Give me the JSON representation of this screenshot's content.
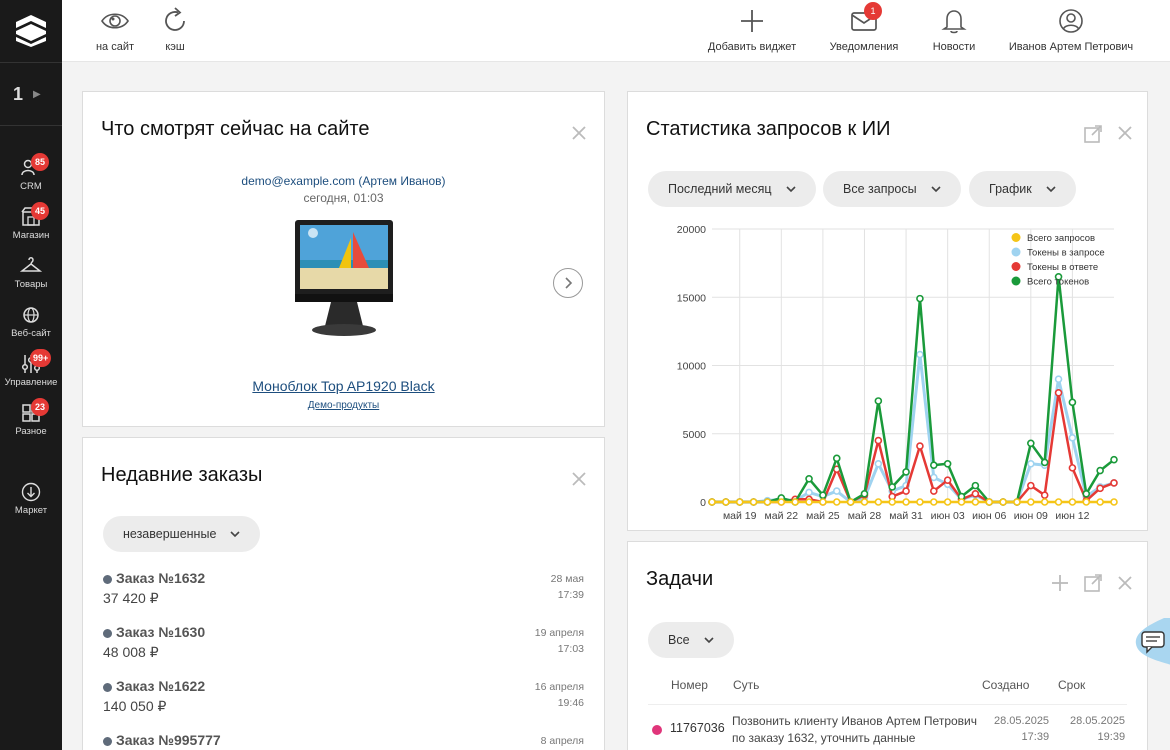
{
  "sidebar": {
    "site_number": "1",
    "items": [
      {
        "label": "CRM",
        "icon": "crm-icon",
        "badge": "85"
      },
      {
        "label": "Магазин",
        "icon": "shop-icon",
        "badge": "45"
      },
      {
        "label": "Товары",
        "icon": "hanger-icon",
        "badge": ""
      },
      {
        "label": "Веб-сайт",
        "icon": "globe-icon",
        "badge": ""
      },
      {
        "label": "Управление",
        "icon": "sliders-icon",
        "badge": "99+"
      },
      {
        "label": "Разное",
        "icon": "grid-icon",
        "badge": "23"
      },
      {
        "label": "Маркет",
        "icon": "download-icon",
        "badge": ""
      }
    ]
  },
  "topbar": {
    "view_site": "на сайт",
    "cache": "кэш",
    "add_widget": "Добавить виджет",
    "notifications": "Уведомления",
    "notifications_badge": "1",
    "news": "Новости",
    "user": "Иванов Артем Петрович"
  },
  "now_viewing": {
    "title": "Что смотрят сейчас на сайте",
    "email": "demo@example.com (Артем Иванов)",
    "time": "сегодня, 01:03",
    "product": "Моноблок Top AP1920 Black",
    "category": "Демо-продукты"
  },
  "orders": {
    "title": "Недавние заказы",
    "filter": "незавершенные",
    "items": [
      {
        "name": "Заказ №1632",
        "sum": "37 420 ₽",
        "date": "28 мая",
        "time": "17:39"
      },
      {
        "name": "Заказ №1630",
        "sum": "48 008 ₽",
        "date": "19 апреля",
        "time": "17:03"
      },
      {
        "name": "Заказ №1622",
        "sum": "140 050 ₽",
        "date": "16 апреля",
        "time": "19:46"
      },
      {
        "name": "Заказ №995777",
        "sum": "",
        "date": "8 апреля",
        "time": ""
      }
    ]
  },
  "ai_stats": {
    "title": "Статистика запросов к ИИ",
    "filters": [
      "Последний месяц",
      "Все запросы",
      "График"
    ]
  },
  "chart_data": {
    "type": "line",
    "x": [
      "май 17",
      "май 18",
      "май 19",
      "май 20",
      "май 21",
      "май 22",
      "май 23",
      "май 24",
      "май 25",
      "май 26",
      "май 27",
      "май 28",
      "май 29",
      "май 30",
      "май 31",
      "июн 01",
      "июн 02",
      "июн 03",
      "июн 04",
      "июн 05",
      "июн 06",
      "июн 07",
      "июн 08",
      "июн 09",
      "июн 10",
      "июн 11",
      "июн 12",
      "июн 13",
      "июн 14",
      "июн 15"
    ],
    "tick_labels": [
      "май 19",
      "май 22",
      "май 25",
      "май 28",
      "май 31",
      "июн 03",
      "июн 06",
      "июн 09",
      "июн 12"
    ],
    "ylim": [
      0,
      20000
    ],
    "yticks": [
      0,
      5000,
      10000,
      15000,
      20000
    ],
    "legend_position": "top-right",
    "series": [
      {
        "name": "Всего запросов",
        "color": "#f5c518",
        "values": [
          0,
          0,
          0,
          0,
          0,
          0,
          0,
          0,
          0,
          0,
          0,
          0,
          0,
          0,
          0,
          0,
          0,
          0,
          0,
          0,
          0,
          0,
          0,
          0,
          0,
          0,
          0,
          0,
          0,
          0
        ]
      },
      {
        "name": "Токены в запросе",
        "color": "#9fd3f0",
        "values": [
          0,
          0,
          0,
          0,
          100,
          200,
          100,
          700,
          400,
          800,
          0,
          300,
          2800,
          800,
          1200,
          10800,
          1800,
          1300,
          200,
          500,
          0,
          0,
          0,
          2800,
          2700,
          9000,
          4700,
          400,
          1100,
          1400
        ]
      },
      {
        "name": "Токены в ответе",
        "color": "#e53935",
        "values": [
          0,
          0,
          0,
          0,
          0,
          0,
          200,
          200,
          0,
          2400,
          0,
          500,
          4500,
          400,
          800,
          4100,
          800,
          1600,
          200,
          600,
          0,
          0,
          0,
          1200,
          500,
          8000,
          2500,
          100,
          1000,
          1400
        ]
      },
      {
        "name": "Всего токенов",
        "color": "#1a9a3a",
        "values": [
          0,
          0,
          0,
          0,
          0,
          300,
          0,
          1700,
          500,
          3200,
          0,
          600,
          7400,
          1100,
          2200,
          14900,
          2700,
          2800,
          400,
          1200,
          0,
          0,
          0,
          4300,
          2900,
          16500,
          7300,
          600,
          2300,
          3100
        ]
      }
    ]
  },
  "tasks": {
    "title": "Задачи",
    "filter": "Все",
    "headers": {
      "num": "Номер",
      "subject": "Суть",
      "created": "Создано",
      "due": "Срок"
    },
    "rows": [
      {
        "num": "11767036",
        "subject": "Позвонить клиенту Иванов Артем Петрович по заказу 1632, уточнить данные",
        "created_date": "28.05.2025",
        "created_time": "17:39",
        "due_date": "28.05.2025",
        "due_time": "19:39"
      }
    ]
  }
}
